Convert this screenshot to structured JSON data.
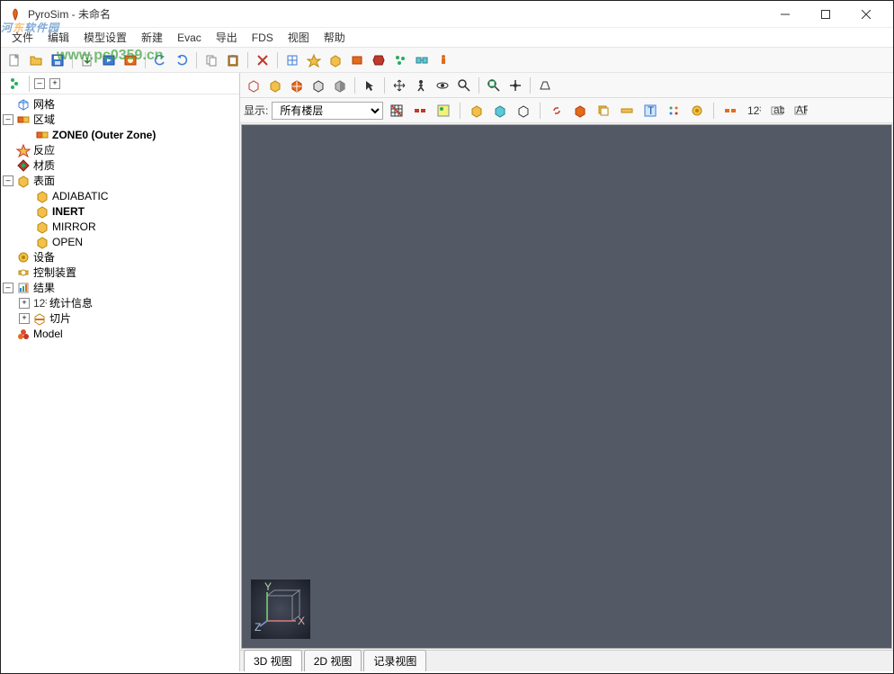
{
  "title": "PyroSim - 未命名",
  "watermark": {
    "cn_prefix": "河",
    "cn_orange": "东",
    "cn_suffix": "软件园",
    "url": "www.pc0359.cn"
  },
  "menu": {
    "file": "文件",
    "edit": "编辑",
    "model": "模型设置",
    "new": "新建",
    "evac": "Evac",
    "export": "导出",
    "fds": "FDS",
    "view": "视图",
    "help": "帮助"
  },
  "tree": {
    "mesh": "网格",
    "zone": "区域",
    "zone0": "ZONE0 (Outer Zone)",
    "reaction": "反应",
    "material": "材质",
    "surface": "表面",
    "surf_adiabatic": "ADIABATIC",
    "surf_inert": "INERT",
    "surf_mirror": "MIRROR",
    "surf_open": "OPEN",
    "device": "设备",
    "control": "控制装置",
    "results": "结果",
    "stats": "统计信息",
    "slice": "切片",
    "model_node": "Model"
  },
  "showbar": {
    "label": "显示:",
    "floor": "所有楼层"
  },
  "tabs": {
    "t3d": "3D 视图",
    "t2d": "2D 视图",
    "trec": "记录视图"
  },
  "axes": {
    "x": "X",
    "y": "Y",
    "z": "Z"
  }
}
